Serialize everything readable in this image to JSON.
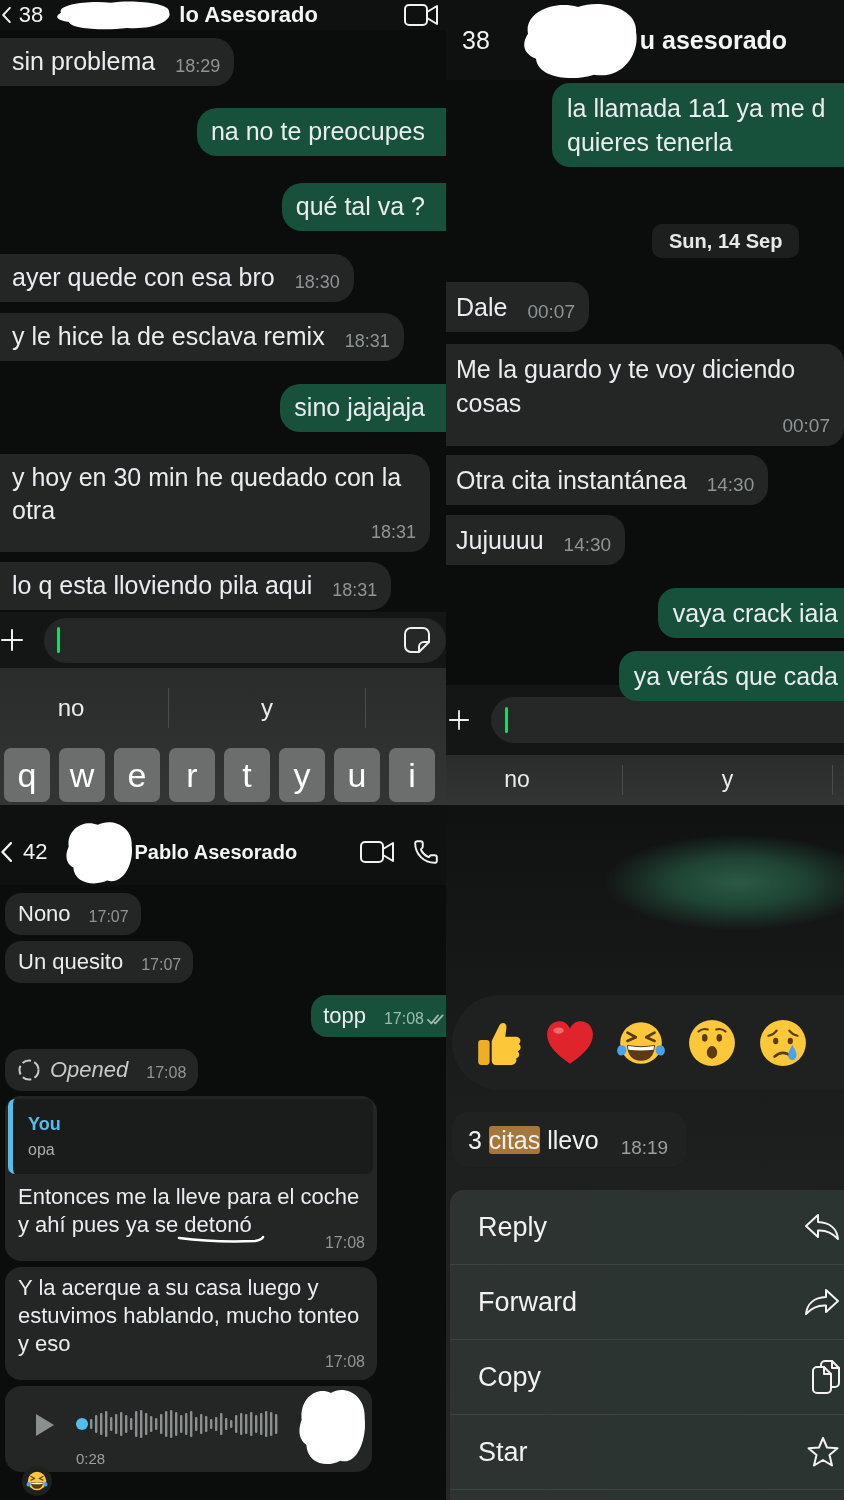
{
  "top_left_screenshot": {
    "header": {
      "unread_count": "38",
      "contact_name": "lo Asesorado"
    },
    "messages": [
      {
        "outgoing": false,
        "text": "sin problema",
        "time": "18:29"
      },
      {
        "outgoing": true,
        "text": "na no te preocupes"
      },
      {
        "outgoing": true,
        "text": "qué tal va ?"
      },
      {
        "outgoing": false,
        "text": "ayer quede con esa bro",
        "time": "18:30"
      },
      {
        "outgoing": false,
        "text": "y le hice la de esclava remix",
        "time": "18:31"
      },
      {
        "outgoing": true,
        "text": "sino jajajaja"
      },
      {
        "outgoing": false,
        "text": "y hoy en 30 min he quedado con la otra",
        "time": "18:31"
      },
      {
        "outgoing": false,
        "text": "lo q esta lloviendo pila aqui",
        "time": "18:31"
      }
    ],
    "keyboard": {
      "suggestions": [
        "no",
        "y"
      ],
      "keys": [
        "q",
        "w",
        "e",
        "r",
        "t",
        "y",
        "u",
        "i"
      ]
    }
  },
  "top_right_screenshot": {
    "header": {
      "unread_count": "38",
      "contact_name": "u asesorado"
    },
    "messages": [
      {
        "kind": "text",
        "outgoing": true,
        "text": "la llamada 1a1 ya me d quieres tenerla"
      },
      {
        "kind": "date",
        "text": "Sun, 14 Sep"
      },
      {
        "kind": "text",
        "outgoing": false,
        "text": "Dale",
        "time": "00:07"
      },
      {
        "kind": "text",
        "outgoing": false,
        "text": "Me la guardo y te voy diciendo cosas",
        "time": "00:07"
      },
      {
        "kind": "text",
        "outgoing": false,
        "text": "Otra cita instantánea",
        "time": "14:30"
      },
      {
        "kind": "text",
        "outgoing": false,
        "text": "Jujuuuu",
        "time": "14:30"
      },
      {
        "kind": "text",
        "outgoing": true,
        "text": "vaya crack iaia"
      },
      {
        "kind": "text",
        "outgoing": true,
        "text": "ya verás que cada"
      }
    ],
    "keyboard": {
      "suggestions": [
        "no",
        "y"
      ]
    }
  },
  "bottom_left_screenshot": {
    "header": {
      "unread_count": "42",
      "contact_name": "Pablo Asesorado"
    },
    "messages": [
      {
        "kind": "text",
        "outgoing": false,
        "text": "Nono",
        "time": "17:07"
      },
      {
        "kind": "text",
        "outgoing": false,
        "text": "Un quesito",
        "time": "17:07"
      },
      {
        "kind": "text",
        "outgoing": true,
        "text": "topp",
        "time": "17:08",
        "read": false
      },
      {
        "kind": "view_once",
        "outgoing": false,
        "text": "Opened",
        "time": "17:08"
      },
      {
        "kind": "text",
        "outgoing": false,
        "quote": {
          "author": "You",
          "text": "opa"
        },
        "text": "Entonces me la lleve para el coche y ahí pues ya se detonó",
        "time": "17:08",
        "hand_drawn_underline": true
      },
      {
        "kind": "text",
        "outgoing": false,
        "text": "Y la acerque a su casa luego y estuvimos hablando, mucho tonteo y eso",
        "time": "17:08"
      },
      {
        "kind": "voice",
        "outgoing": false,
        "duration": "0:28",
        "playing": false,
        "level": 0,
        "reaction": {
          "kind": "laughing"
        }
      }
    ]
  },
  "bottom_right_screenshot": {
    "reactions": [
      {
        "kind": "thumbs_up"
      },
      {
        "kind": "heart"
      },
      {
        "kind": "laughing"
      },
      {
        "kind": "surprised"
      },
      {
        "kind": "crying"
      }
    ],
    "selected_message": {
      "parts": [
        {
          "text": "3 ",
          "highlighted": false
        },
        {
          "text": "citas",
          "highlighted": true
        },
        {
          "text": " llevo",
          "highlighted": false
        }
      ],
      "time": "18:19"
    },
    "menu": [
      {
        "kind": "reply",
        "label": "Reply"
      },
      {
        "kind": "forward",
        "label": "Forward"
      },
      {
        "kind": "copy",
        "label": "Copy"
      },
      {
        "kind": "star",
        "label": "Star"
      }
    ]
  }
}
